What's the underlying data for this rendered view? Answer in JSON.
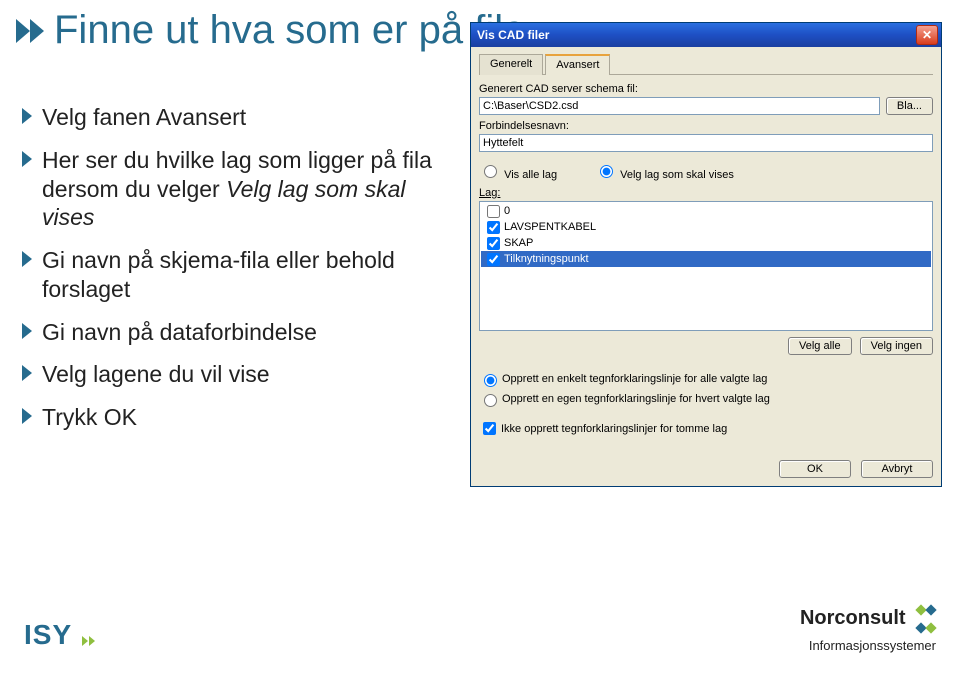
{
  "slide": {
    "title": "Finne ut hva som er på fila",
    "bullets": [
      {
        "pre": "Velg fanen Avansert"
      },
      {
        "pre": "Her ser du hvilke lag som ligger på fila dersom du velger ",
        "it": "Velg lag som skal vises"
      },
      {
        "pre": "Gi navn på skjema-fila eller behold forslaget"
      },
      {
        "pre": "Gi navn på dataforbindelse"
      },
      {
        "pre": "Velg lagene du vil vise"
      },
      {
        "pre": "Trykk OK"
      }
    ],
    "isy": "ISY",
    "norconsult_main": "Norconsult",
    "norconsult_sub": "Informasjonssystemer"
  },
  "dialog": {
    "title": "Vis CAD filer",
    "tabs": {
      "generelt": "Generelt",
      "avansert": "Avansert"
    },
    "schema_label": "Generert CAD server schema fil:",
    "schema_value": "C:\\Baser\\CSD2.csd",
    "bla_btn": "Bla...",
    "conn_label": "Forbindelsesnavn:",
    "conn_value": "Hyttefelt",
    "radio": {
      "vis_alle": "Vis alle lag",
      "velg_lag": "Velg lag som skal vises"
    },
    "radio_selected": "velg_lag",
    "lag_label": "Lag:",
    "layers": [
      {
        "name": "0",
        "checked": false,
        "selected": false
      },
      {
        "name": "LAVSPENTKABEL",
        "checked": true,
        "selected": false
      },
      {
        "name": "SKAP",
        "checked": true,
        "selected": false
      },
      {
        "name": "Tilknytningspunkt",
        "checked": true,
        "selected": true
      }
    ],
    "velg_alle_btn": "Velg alle",
    "velg_ingen_btn": "Velg ingen",
    "explain_opts": {
      "enkelt": "Opprett en enkelt tegnforklaringslinje for alle valgte lag",
      "egen": "Opprett en egen tegnforklaringslinje for hvert valgte lag",
      "ikke_tomme": "Ikke opprett tegnforklaringslinjer for tomme lag"
    },
    "explain_selected": "enkelt",
    "ikke_tomme_checked": true,
    "ok_btn": "OK",
    "avbryt_btn": "Avbryt"
  }
}
